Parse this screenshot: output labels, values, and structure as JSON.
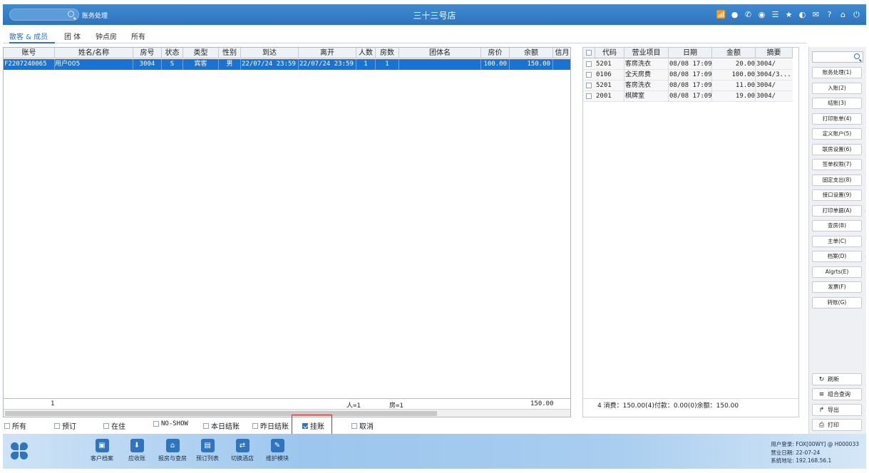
{
  "topbar": {
    "module_title": "账务处理",
    "store_title": "三十三号店",
    "icons": [
      "wifi-icon",
      "chat-icon",
      "phone-icon",
      "palette-icon",
      "menu-icon",
      "star-icon",
      "theme-icon",
      "mail-icon",
      "help-icon",
      "home-icon",
      "power-icon"
    ]
  },
  "tabs": [
    "散客 & 成员",
    "团 体",
    "钟点房",
    "所有"
  ],
  "left_grid": {
    "columns": [
      "账号",
      "姓名/名称",
      "房号",
      "状态",
      "类型",
      "性别",
      "到达",
      "离开",
      "人数",
      "房数",
      "团体名",
      "房价",
      "余额",
      "信月"
    ],
    "rows": [
      [
        "F2207240065",
        "用户005",
        "3004",
        "S",
        "宾客",
        "男",
        "22/07/24 23:59",
        "22/07/24 23:59",
        "1",
        "1",
        "",
        "100.00",
        "150.00",
        ""
      ]
    ],
    "footer": {
      "count": "1",
      "persons": "人=1",
      "rooms": "房=1",
      "balance": "150.00"
    }
  },
  "right_grid": {
    "columns": [
      "代码",
      "营业项目",
      "日期",
      "金额",
      "摘要"
    ],
    "rows": [
      [
        "5201",
        "客房洗衣",
        "08/08 17:09",
        "20.00",
        "3004/"
      ],
      [
        "0106",
        "全天房费",
        "08/08 17:09",
        "100.00",
        "3004/3..."
      ],
      [
        "5201",
        "客房洗衣",
        "08/08 17:09",
        "11.00",
        "3004/"
      ],
      [
        "2001",
        "棋牌室",
        "08/08 17:09",
        "19.00",
        "3004/"
      ]
    ],
    "footer": "4 消费：150.00(4)付款：0.00(0)余额：150.00"
  },
  "side_panel": {
    "buttons": [
      "账务处理(1)",
      "入账(2)",
      "结账(3)",
      "打印账单(4)",
      "定义账户(5)",
      "联房设置(6)",
      "签单权限(7)",
      "固定支出(8)",
      "接口设置(9)",
      "打印单据(A)",
      "查房(B)",
      "主单(C)",
      "档案(D)",
      "Algrts(E)",
      "发票(F)",
      "转账(G)"
    ],
    "actions": [
      {
        "label": "刷新",
        "icon": "refresh-icon"
      },
      {
        "label": "组合查询",
        "icon": "list-icon"
      },
      {
        "label": "导出",
        "icon": "export-icon"
      },
      {
        "label": "打印",
        "icon": "printer-icon"
      }
    ]
  },
  "filters": [
    {
      "label": "所有",
      "checked": false
    },
    {
      "label": "预订",
      "checked": false
    },
    {
      "label": "在住",
      "checked": false
    },
    {
      "label": "NO-SHOW",
      "checked": false
    },
    {
      "label": "本日结账",
      "checked": false
    },
    {
      "label": "昨日结账",
      "checked": false
    },
    {
      "label": "挂账",
      "checked": true
    },
    {
      "label": "取消",
      "checked": false
    }
  ],
  "bottombar": {
    "buttons": [
      {
        "label": "客户档案",
        "icon": "customer-profile-icon"
      },
      {
        "label": "应收账",
        "icon": "receivable-icon"
      },
      {
        "label": "报房与查房",
        "icon": "room-status-icon"
      },
      {
        "label": "预订列表",
        "icon": "reservation-list-icon"
      },
      {
        "label": "切换酒店",
        "icon": "switch-hotel-icon"
      },
      {
        "label": "维护模块",
        "icon": "maintenance-icon"
      }
    ],
    "sysinfo": {
      "user": "用户登录:  FOX[00WY] @ H000033",
      "business_date": "营业日期:  22-07-24",
      "system_address": "系统地址:  192.168.56.1"
    }
  },
  "colors": {
    "primary": "#2f74bd",
    "selected_row": "#1a73d2",
    "highlight_border": "#e02020"
  }
}
